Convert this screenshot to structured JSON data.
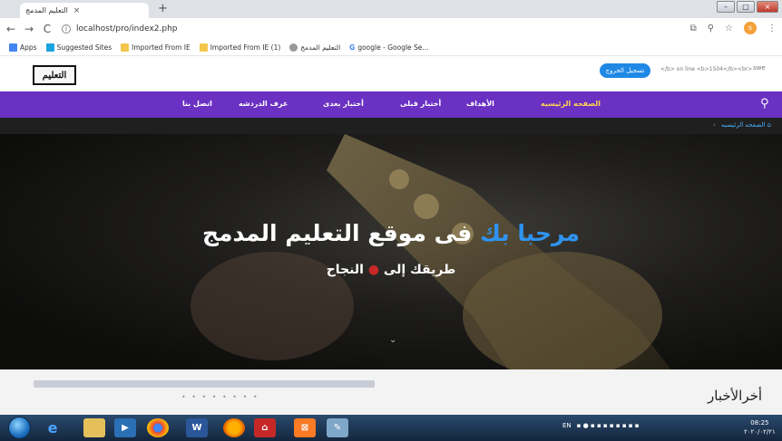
{
  "browser": {
    "tab_title": "التعليم المدمج",
    "tab_close": "×",
    "new_tab": "+",
    "address": "localhost/pro/index2.php",
    "bookmarks": [
      "Apps",
      "Suggested Sites",
      "Imported From IE",
      "Imported From IE (1)",
      "التعليم المدمج",
      "google - Google Se..."
    ],
    "profile_initial": "s"
  },
  "header": {
    "logo_text": "التعليم",
    "login_button": "تسجيل الخروج",
    "note": "</b> on line <b>1504</b><br>",
    "broken_image_alt": "swe"
  },
  "nav": {
    "items": [
      "الصفحه الرئيسيه",
      "الأهداف",
      "أختبار قبلى",
      "أختبار بعدى",
      "غرف الدردشه",
      "اتصل بنا"
    ],
    "active_index": 0
  },
  "breadcrumb": {
    "label": "الصفحه الرئيسيه"
  },
  "hero": {
    "title_accent": "مرحبا بك",
    "title_rest": "فى موقع التعليم المدمج",
    "subtitle_a": "طريقك إلى",
    "subtitle_b": "النجاح"
  },
  "news": {
    "title": "أخرالأخبار",
    "dots": "• • • • • • • •"
  },
  "taskbar": {
    "lang": "EN",
    "time": "08:25",
    "date": "٢٠٢٠/٠٢/٢١"
  }
}
